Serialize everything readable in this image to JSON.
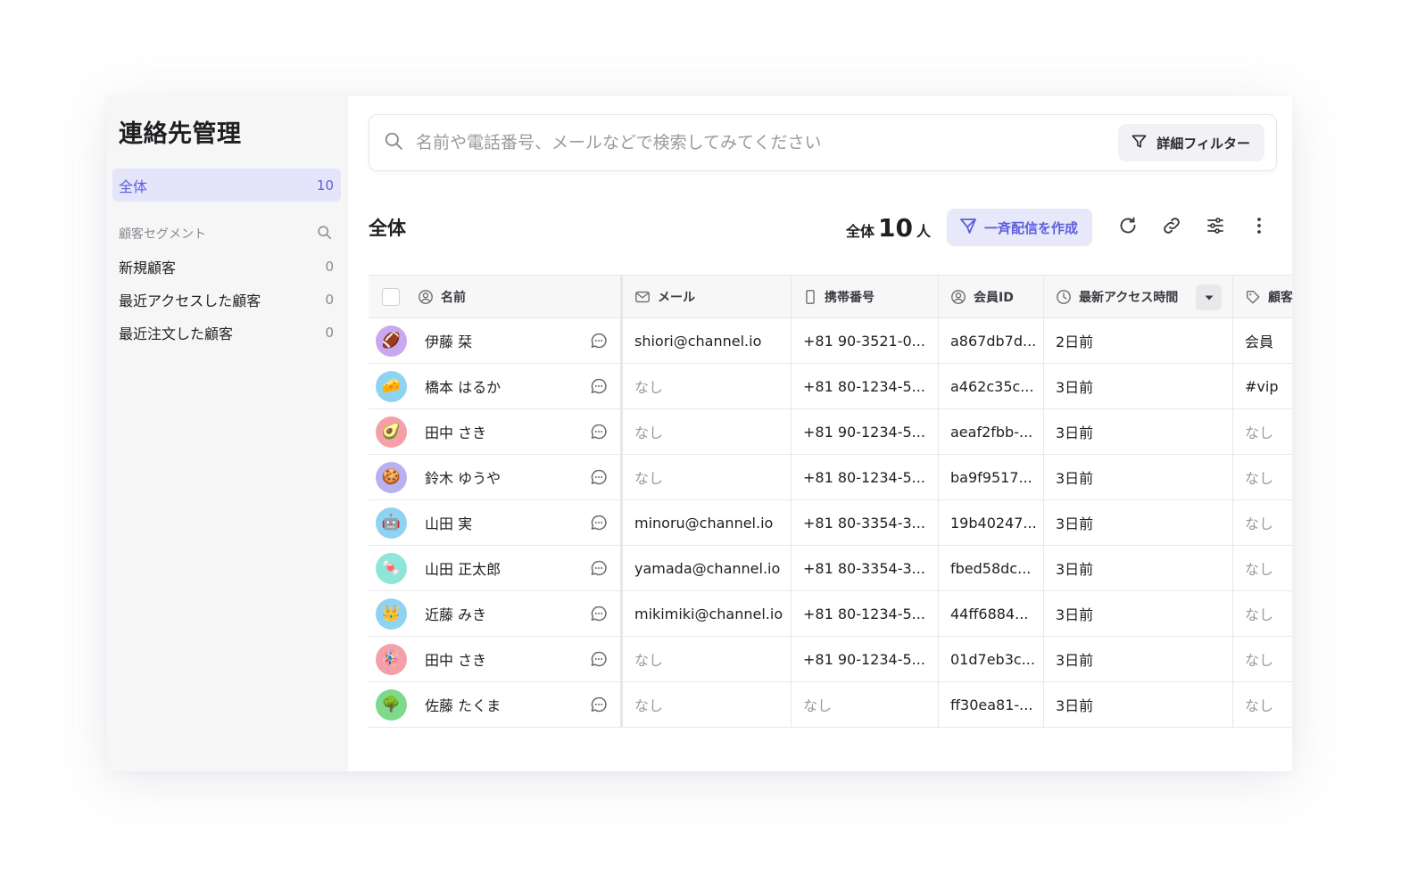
{
  "sidebar": {
    "title": "連絡先管理",
    "all": {
      "label": "全体",
      "count": "10"
    },
    "segments_header": "顧客セグメント",
    "segments": [
      {
        "label": "新規顧客",
        "count": "0"
      },
      {
        "label": "最近アクセスした顧客",
        "count": "0"
      },
      {
        "label": "最近注文した顧客",
        "count": "0"
      }
    ]
  },
  "search": {
    "placeholder": "名前や電話番号、メールなどで検索してみてください",
    "filter_label": "詳細フィルター"
  },
  "toolbar": {
    "title": "全体",
    "total_prefix": "全体",
    "total_count": "10",
    "total_suffix": "人",
    "broadcast_label": "一斉配信を作成"
  },
  "table": {
    "headers": {
      "name": "名前",
      "mail": "メール",
      "phone": "携帯番号",
      "member_id": "会員ID",
      "last_access": "最新アクセス時間",
      "tag": "顧客"
    },
    "rows": [
      {
        "avatar": "🏈",
        "avatar_bg": "#c9a8f0",
        "name": "伊藤 栞",
        "mail": "shiori@channel.io",
        "phone": "+81 90-3521-0...",
        "member_id": "a867db7d...",
        "last_access": "2日前",
        "tag": "会員"
      },
      {
        "avatar": "🧀",
        "avatar_bg": "#8fd3f2",
        "name": "橋本 はるか",
        "mail": "なし",
        "phone": "+81 80-1234-5...",
        "member_id": "a462c35c...",
        "last_access": "3日前",
        "tag": "#vip"
      },
      {
        "avatar": "🥑",
        "avatar_bg": "#f5a0a8",
        "name": "田中 さき",
        "mail": "なし",
        "phone": "+81 90-1234-5...",
        "member_id": "aeaf2fbb-...",
        "last_access": "3日前",
        "tag": "なし"
      },
      {
        "avatar": "🍪",
        "avatar_bg": "#b8b0f0",
        "name": "鈴木 ゆうや",
        "mail": "なし",
        "phone": "+81 80-1234-5...",
        "member_id": "ba9f9517...",
        "last_access": "3日前",
        "tag": "なし"
      },
      {
        "avatar": "🤖",
        "avatar_bg": "#8fd3f2",
        "name": "山田 実",
        "mail": "minoru@channel.io",
        "phone": "+81 80-3354-3...",
        "member_id": "19b40247...",
        "last_access": "3日前",
        "tag": "なし"
      },
      {
        "avatar": "🍬",
        "avatar_bg": "#8ee6d8",
        "name": "山田 正太郎",
        "mail": "yamada@channel.io",
        "phone": "+81 80-3354-3...",
        "member_id": "fbed58dc...",
        "last_access": "3日前",
        "tag": "なし"
      },
      {
        "avatar": "👑",
        "avatar_bg": "#8fd3f2",
        "name": "近藤 みき",
        "mail": "mikimiki@channel.io",
        "phone": "+81 80-1234-5...",
        "member_id": "44ff6884...",
        "last_access": "3日前",
        "tag": "なし"
      },
      {
        "avatar": "🪅",
        "avatar_bg": "#f5a0a8",
        "name": "田中 さき",
        "mail": "なし",
        "phone": "+81 90-1234-5...",
        "member_id": "01d7eb3c...",
        "last_access": "3日前",
        "tag": "なし"
      },
      {
        "avatar": "🌳",
        "avatar_bg": "#7fd98a",
        "name": "佐藤 たくま",
        "mail": "なし",
        "phone": "なし",
        "member_id": "ff30ea81-...",
        "last_access": "3日前",
        "tag": "なし"
      }
    ]
  },
  "empty_value": "なし",
  "colors": {
    "accent": "#5d5fdb",
    "accent_bg": "#e4e4fa",
    "sidebar_bg": "#f6f6f7"
  }
}
